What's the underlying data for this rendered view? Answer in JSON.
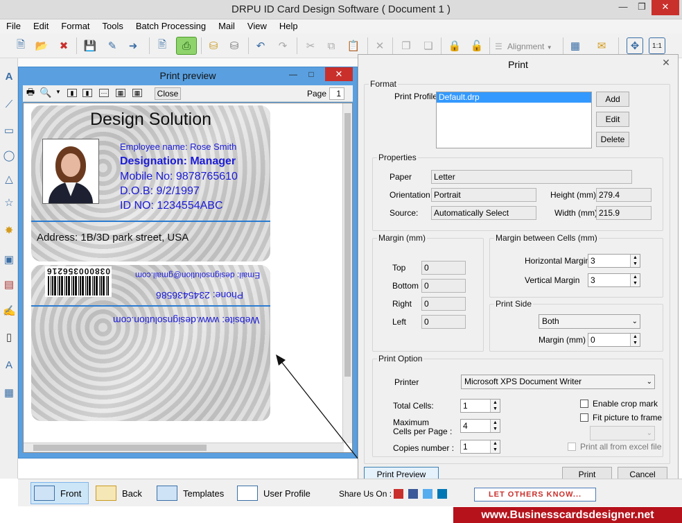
{
  "app": {
    "title": "DRPU ID Card Design Software ( Document 1 )",
    "menu": [
      "File",
      "Edit",
      "Format",
      "Tools",
      "Batch Processing",
      "Mail",
      "View",
      "Help"
    ],
    "toolbar": {
      "alignment_label": "Alignment"
    }
  },
  "preview": {
    "title": "Print preview",
    "close_label": "Close",
    "page_label": "Page",
    "page_value": "1",
    "front": {
      "company": "Design Solution",
      "employee": "Employee name: Rose Smith",
      "designation": "Designation: Manager",
      "mobile": "Mobile No:   9878765610",
      "dob": "D.O.B:     9/2/1997",
      "id": "ID NO:   1234554ABC",
      "address": "Address: 1B/3D park street, USA"
    },
    "back": {
      "barcode": "038000356216",
      "email": "Email: designsolution@gmail.com",
      "phone": "Phone: 2345436586",
      "website": "Website: www.designsolution.com"
    }
  },
  "print_dialog": {
    "title": "Print",
    "format_caption": "Format",
    "profile_label": "Print Profile",
    "profile_item": "Default.drp",
    "add": "Add",
    "edit": "Edit",
    "delete": "Delete",
    "properties_caption": "Properties",
    "paper_label": "Paper",
    "paper_value": "Letter",
    "orientation_label": "Orientation",
    "orientation_value": "Portrait",
    "source_label": "Source:",
    "source_value": "Automatically Select",
    "height_label": "Height (mm)",
    "height_value": "279.4",
    "width_label": "Width (mm)",
    "width_value": "215.9",
    "margin_caption": "Margin (mm)",
    "top_label": "Top",
    "top_value": "0",
    "bottom_label": "Bottom",
    "bottom_value": "0",
    "right_label": "Right",
    "right_value": "0",
    "left_label": "Left",
    "left_value": "0",
    "mbc_caption": "Margin between Cells (mm)",
    "hmargin_label": "Horizontal Margin",
    "hmargin_value": "3",
    "vmargin_label": "Vertical Margin",
    "vmargin_value": "3",
    "side_caption": "Print Side",
    "side_value": "Both",
    "side_margin_label": "Margin (mm)",
    "side_margin_value": "0",
    "option_caption": "Print Option",
    "printer_label": "Printer",
    "printer_value": "Microsoft XPS Document Writer",
    "total_cells_label": "Total Cells:",
    "total_cells_value": "1",
    "max_cells_label1": "Maximum",
    "max_cells_label2": "Cells per Page :",
    "max_cells_value": "4",
    "copies_label": "Copies number :",
    "copies_value": "1",
    "crop_label": "Enable crop mark",
    "fit_label": "Fit picture to frame",
    "excel_label": "Print all from excel file",
    "preview_btn": "Print Preview",
    "print_btn": "Print",
    "cancel_btn": "Cancel"
  },
  "bottom": {
    "front": "Front",
    "back": "Back",
    "templates": "Templates",
    "user_profile": "User Profile",
    "share": "Share Us On :",
    "let_others": "LET OTHERS KNOW...",
    "website": "www.Businesscardsdesigner.net"
  }
}
